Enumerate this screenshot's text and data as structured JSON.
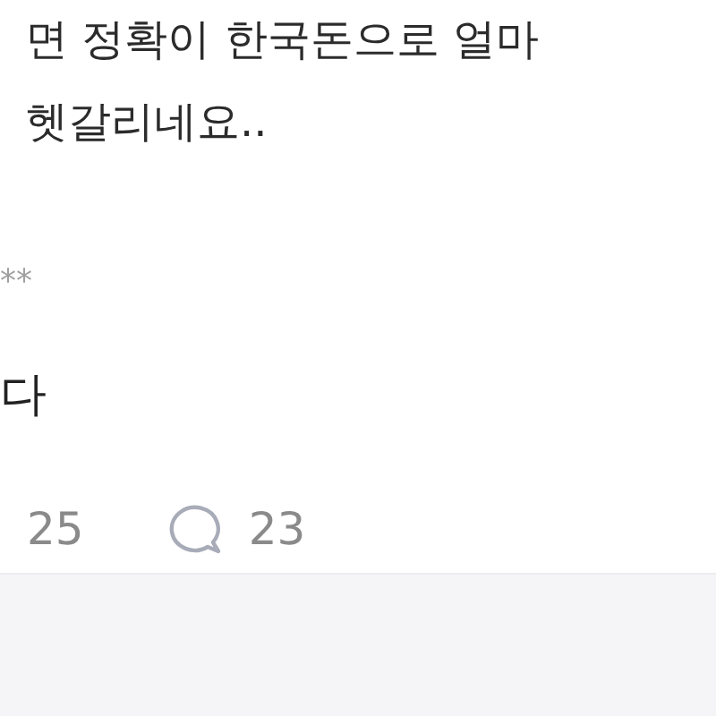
{
  "post": {
    "body_lines": [
      "면 정확이 한국돈으로 얼마",
      "헷갈리네요.."
    ]
  },
  "comment": {
    "author": "**",
    "text": "다",
    "likes": "25",
    "replies": "23"
  }
}
